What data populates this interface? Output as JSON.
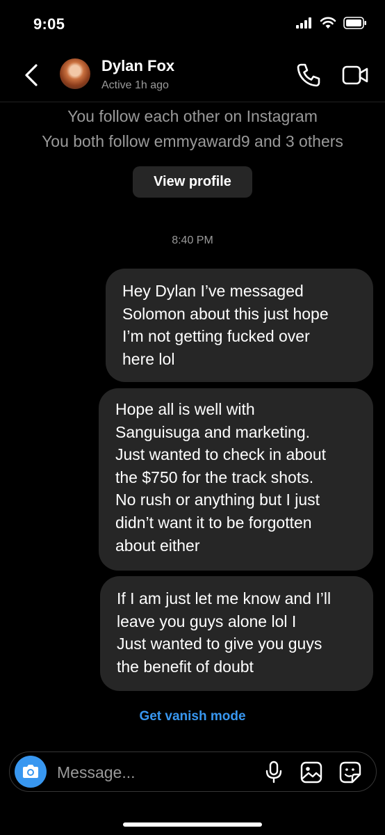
{
  "status_bar": {
    "time": "9:05"
  },
  "header": {
    "name": "Dylan Fox",
    "status": "Active 1h ago"
  },
  "profile_info": {
    "line1": "You follow each other on Instagram",
    "line2": "You both follow emmyaward9 and 3 others",
    "view_profile_label": "View profile"
  },
  "thread": {
    "timestamp": "8:40 PM",
    "messages": [
      {
        "text": "Hey Dylan I’ve messaged\nSolomon about this just hope\nI’m not getting fucked over\nhere lol"
      },
      {
        "text": "Hope all is well with\nSanguisuga and marketing.\nJust wanted to check in about\nthe $750 for the track shots.\nNo rush or anything but I just\ndidn’t want it to be forgotten\nabout either"
      },
      {
        "text": "If I am just let me know and I’ll\nleave you guys alone lol I\nJust wanted to give you guys\nthe benefit of doubt"
      }
    ]
  },
  "vanish_mode_label": "Get vanish mode",
  "composer": {
    "placeholder": "Message..."
  },
  "colors": {
    "accent": "#3897f0",
    "bubble": "#262626",
    "background": "#000000"
  }
}
